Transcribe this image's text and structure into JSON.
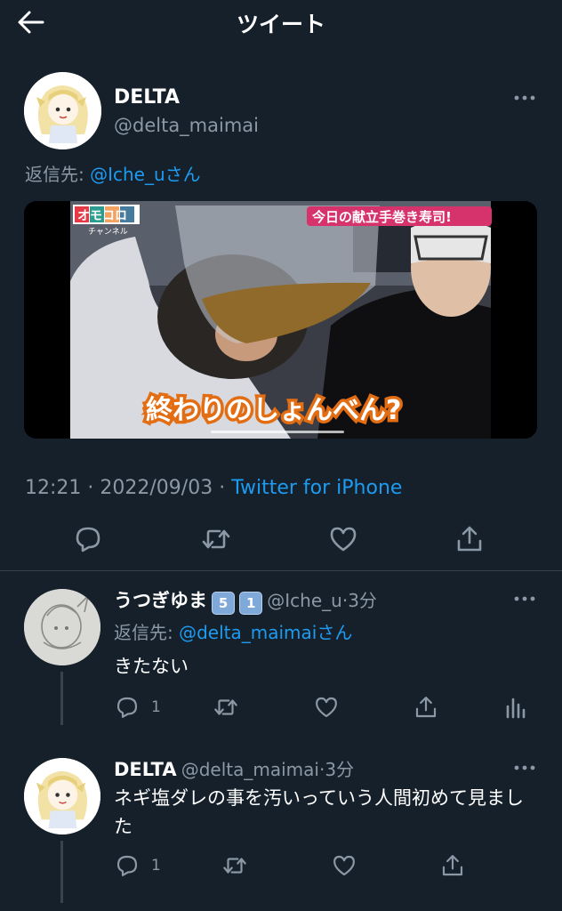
{
  "header": {
    "title": "ツイート"
  },
  "main_tweet": {
    "author_name": "DELTA",
    "author_handle": "@delta_maimai",
    "reply_prefix": "返信先:",
    "reply_to": "@Iche_u",
    "reply_suffix": "さん",
    "media": {
      "logo_text": "オモコロ",
      "logo_sub": "チャンネル",
      "caption_top": "今日の献立手巻き寿司!",
      "subtitle": "終わりのしょんべん?"
    },
    "time": "12:21",
    "date": "2022/09/03",
    "source": "Twitter for iPhone"
  },
  "replies": [
    {
      "author_name": "うつぎゆま",
      "badges": [
        "5",
        "1"
      ],
      "author_handle": "@Iche_u",
      "time_ago": "3分",
      "reply_prefix": "返信先:",
      "reply_to": "@delta_maimai",
      "reply_suffix": "さん",
      "text": "きたない",
      "reply_count": "1"
    },
    {
      "author_name": "DELTA",
      "author_handle": "@delta_maimai",
      "time_ago": "3分",
      "text": "ネギ塩ダレの事を汚いっていう人間初めて見ました",
      "reply_count": "1"
    }
  ],
  "icons": {
    "back": "arrow-left-icon",
    "more": "more-dots-icon",
    "reply": "comment-icon",
    "retweet": "retweet-icon",
    "like": "heart-icon",
    "share": "share-icon",
    "analytics": "analytics-icon"
  },
  "colors": {
    "background": "#15202b",
    "link": "#1d9bf0",
    "secondary_text": "#8b98a5",
    "divider": "#38444d"
  }
}
